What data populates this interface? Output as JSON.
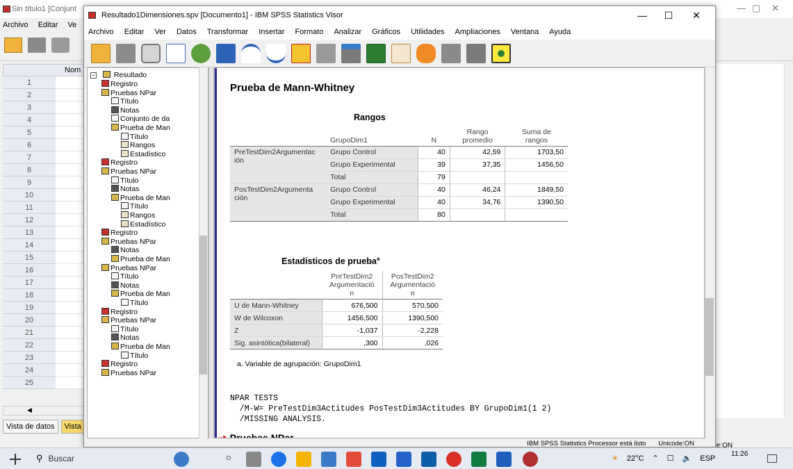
{
  "back_window": {
    "title": "Sin título1 [Conjunt",
    "menu": [
      "Archivo",
      "Editar",
      "Ve"
    ],
    "column_header": "Nom",
    "row_numbers": [
      "1",
      "2",
      "3",
      "4",
      "5",
      "6",
      "7",
      "8",
      "9",
      "10",
      "11",
      "12",
      "13",
      "14",
      "15",
      "16",
      "17",
      "18",
      "19",
      "20",
      "21",
      "22",
      "23",
      "24",
      "25"
    ],
    "tabs": [
      "Vista de datos",
      "Vista"
    ],
    "status": "te:ON"
  },
  "window": {
    "title": "Resultado1Dimensiones.spv [Documento1] - IBM SPSS Statistics Visor",
    "minimize": "—",
    "maximize": "☐",
    "close": "✕"
  },
  "menu": [
    "Archivo",
    "Editar",
    "Ver",
    "Datos",
    "Transformar",
    "Insertar",
    "Formato",
    "Analizar",
    "Gráficos",
    "Utilidades",
    "Ampliaciones",
    "Ventana",
    "Ayuda"
  ],
  "toolbar": [
    "open-icon",
    "save-icon",
    "print-icon",
    "print-preview-icon",
    "export-icon",
    "recall-dialog-icon",
    "undo-icon",
    "redo-icon",
    "goto-data-icon",
    "goto-variable-icon",
    "insert-case-icon",
    "variables-icon",
    "insert-output-icon",
    "designate-window-icon",
    "hide-icon",
    "show-icon"
  ],
  "outline": {
    "root": "Resultado",
    "nodes": [
      {
        "label": "Registro",
        "icon": "log-icon"
      },
      {
        "label": "Pruebas NPar",
        "icon": "output-icon"
      },
      {
        "label": "Título",
        "icon": "title-icon"
      },
      {
        "label": "Notas",
        "icon": "notes-icon"
      },
      {
        "label": "Conjunto de da",
        "icon": "dataset-icon"
      },
      {
        "label": "Prueba de Man",
        "icon": "output-icon"
      },
      {
        "label": "Título",
        "icon": "title-icon"
      },
      {
        "label": "Rangos",
        "icon": "table-icon"
      },
      {
        "label": "Estadístico",
        "icon": "table-icon"
      },
      {
        "label": "Registro",
        "icon": "log-icon"
      },
      {
        "label": "Pruebas NPar",
        "icon": "output-icon"
      },
      {
        "label": "Título",
        "icon": "title-icon"
      },
      {
        "label": "Notas",
        "icon": "notes-icon"
      },
      {
        "label": "Prueba de Man",
        "icon": "output-icon"
      },
      {
        "label": "Título",
        "icon": "title-icon"
      },
      {
        "label": "Rangos",
        "icon": "table-icon"
      },
      {
        "label": "Estadístico",
        "icon": "table-icon"
      },
      {
        "label": "Registro",
        "icon": "log-icon"
      },
      {
        "label": "Pruebas NPar",
        "icon": "output-icon"
      },
      {
        "label": "Notas",
        "icon": "notes-icon"
      },
      {
        "label": "Prueba de Man",
        "icon": "output-icon"
      },
      {
        "label": "Pruebas NPar",
        "icon": "output-icon"
      },
      {
        "label": "Título",
        "icon": "title-icon"
      },
      {
        "label": "Notas",
        "icon": "notes-icon"
      },
      {
        "label": "Prueba de Man",
        "icon": "output-icon"
      },
      {
        "label": "Título",
        "icon": "title-icon"
      },
      {
        "label": "Registro",
        "icon": "log-icon"
      },
      {
        "label": "Pruebas NPar",
        "icon": "output-icon"
      },
      {
        "label": "Título",
        "icon": "title-icon"
      },
      {
        "label": "Notas",
        "icon": "notes-icon"
      },
      {
        "label": "Prueba de Man",
        "icon": "output-icon"
      },
      {
        "label": "Título",
        "icon": "title-icon"
      },
      {
        "label": "Registro",
        "icon": "log-icon"
      },
      {
        "label": "Pruebas NPar",
        "icon": "output-icon"
      }
    ]
  },
  "content": {
    "heading": "Prueba de Mann-Whitney",
    "ranks": {
      "title": "Rangos",
      "col_group": "GrupoDim1",
      "col_n": "N",
      "col_mean_line1": "Rango",
      "col_mean_line2": "promedio",
      "col_sum_line1": "Suma de",
      "col_sum_line2": "rangos",
      "var1_line1": "PreTestDim2Argumentac",
      "var1_line2": "ión",
      "var2_line1": "PosTestDim2Argumenta",
      "var2_line2": "ción",
      "rows": [
        {
          "group": "Grupo Control",
          "n": "40",
          "mean": "42,59",
          "sum": "1703,50"
        },
        {
          "group": "Grupo Experimental",
          "n": "39",
          "mean": "37,35",
          "sum": "1456,50"
        },
        {
          "group": "Total",
          "n": "79",
          "mean": "",
          "sum": ""
        },
        {
          "group": "Grupo Control",
          "n": "40",
          "mean": "46,24",
          "sum": "1849,50"
        },
        {
          "group": "Grupo Experimental",
          "n": "40",
          "mean": "34,76",
          "sum": "1390,50"
        },
        {
          "group": "Total",
          "n": "80",
          "mean": "",
          "sum": ""
        }
      ]
    },
    "stats": {
      "title": "Estadísticos de prueba",
      "superscript": "a",
      "col1": [
        "PreTestDim2",
        "Argumentació",
        "n"
      ],
      "col2": [
        "PosTestDim2",
        "Argumentació",
        "n"
      ],
      "rows": [
        {
          "label": "U de Mann-Whitney",
          "v1": "676,500",
          "v2": "570,500"
        },
        {
          "label": "W de Wilcoxon",
          "v1": "1456,500",
          "v2": "1390,500"
        },
        {
          "label": "Z",
          "v1": "-1,037",
          "v2": "-2,228"
        },
        {
          "label": "Sig. asintótica(bilateral)",
          "v1": ",300",
          "v2": ",026"
        }
      ],
      "footnote": "a. Variable de agrupación: GrupoDim1"
    },
    "syntax": {
      "line1": "NPAR TESTS",
      "line2": "  /M-W= PreTestDim3Actitudes PosTestDim3Actitudes BY GrupoDim1(1 2)",
      "line3": "  /MISSING ANALYSIS."
    },
    "next_heading": "Pruebas NPar"
  },
  "status": {
    "processor": "IBM SPSS Statistics Processor está listo",
    "unicode": "Unicode:ON"
  },
  "taskbar": {
    "search": "Buscar",
    "weather": "22°C",
    "lang": "ESP",
    "time": "11:26"
  }
}
